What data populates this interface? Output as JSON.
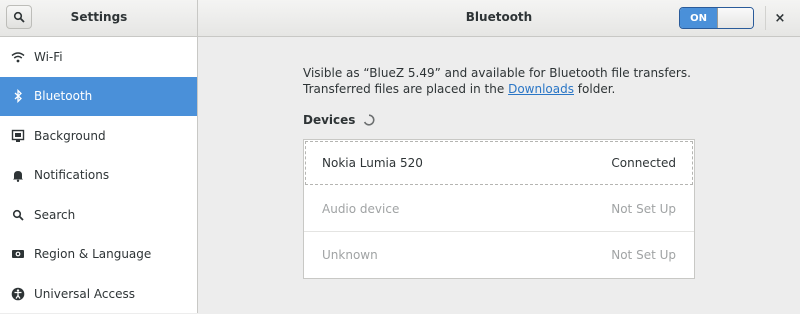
{
  "header": {
    "left_title": "Settings",
    "title": "Bluetooth",
    "switch_label": "ON",
    "close_glyph": "×"
  },
  "sidebar": {
    "items": [
      {
        "label": "Wi-Fi",
        "icon": "wifi-icon"
      },
      {
        "label": "Bluetooth",
        "icon": "bluetooth-icon",
        "selected": true
      },
      {
        "label": "Background",
        "icon": "background-icon"
      },
      {
        "label": "Notifications",
        "icon": "bell-icon"
      },
      {
        "label": "Search",
        "icon": "search-icon"
      },
      {
        "label": "Region & Language",
        "icon": "region-icon"
      },
      {
        "label": "Universal Access",
        "icon": "accessibility-icon"
      }
    ]
  },
  "main": {
    "desc_line1": "Visible as “BlueZ 5.49” and available for Bluetooth file transfers.",
    "desc_line2_pre": "Transferred files are placed in the ",
    "desc_link": "Downloads",
    "desc_line2_post": " folder.",
    "devices_title": "Devices",
    "devices": [
      {
        "name": "Nokia Lumia 520",
        "status": "Connected"
      },
      {
        "name": "Audio device",
        "status": "Not Set Up"
      },
      {
        "name": "Unknown",
        "status": "Not Set Up"
      }
    ]
  },
  "colors": {
    "accent": "#4a90d9",
    "link": "#2a76c6",
    "dim_text": "#a0a3a4"
  }
}
